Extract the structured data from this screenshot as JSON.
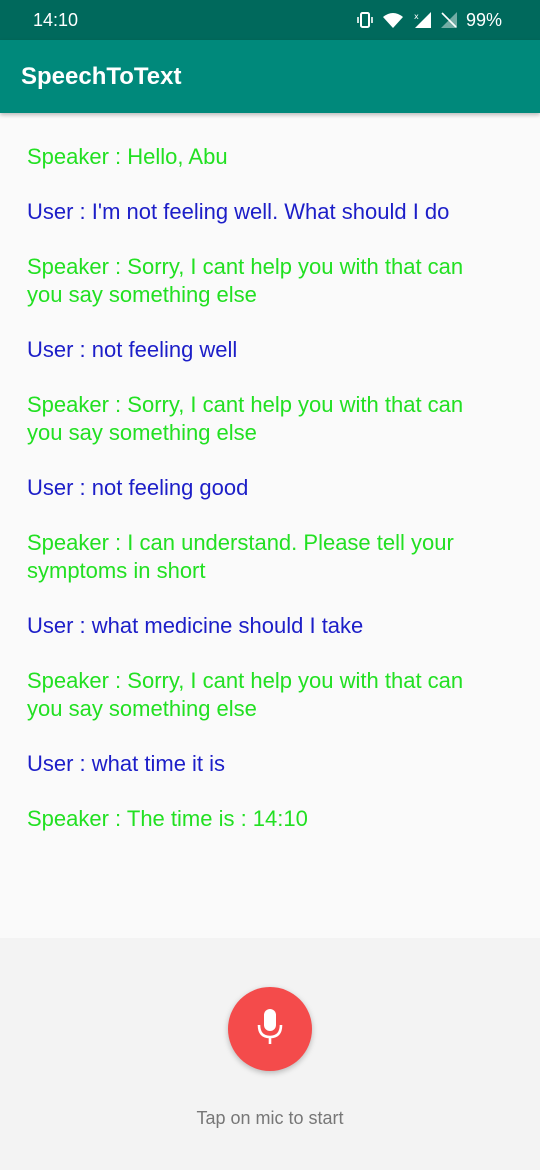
{
  "status_bar": {
    "time": "14:10",
    "battery": "99%",
    "icons": [
      "vibrate-icon",
      "wifi-icon",
      "signal-icon",
      "no-sim-icon"
    ]
  },
  "app_bar": {
    "title": "SpeechToText",
    "color": "#00897b"
  },
  "messages": [
    {
      "role": "speaker",
      "text": "Speaker : Hello, Abu"
    },
    {
      "role": "user",
      "text": "User : I'm not feeling well. What should I do"
    },
    {
      "role": "speaker",
      "text": "Speaker : Sorry, I cant help you with that can you say something else"
    },
    {
      "role": "user",
      "text": "User : not feeling well"
    },
    {
      "role": "speaker",
      "text": "Speaker : Sorry, I cant help you with that can you say something else"
    },
    {
      "role": "user",
      "text": "User : not feeling good"
    },
    {
      "role": "speaker",
      "text": "Speaker : I can understand. Please tell your symptoms in short"
    },
    {
      "role": "user",
      "text": "User : what medicine should I take"
    },
    {
      "role": "speaker",
      "text": "Speaker : Sorry, I cant help you with that can you say something else"
    },
    {
      "role": "user",
      "text": "User : what time it is"
    },
    {
      "role": "speaker",
      "text": "Speaker : The time is : 14:10"
    }
  ],
  "colors": {
    "speaker": "#22e022",
    "user": "#1c1ec8",
    "mic_button": "#f44b4b"
  },
  "mic": {
    "icon": "microphone-icon",
    "hint": "Tap on mic to start"
  }
}
